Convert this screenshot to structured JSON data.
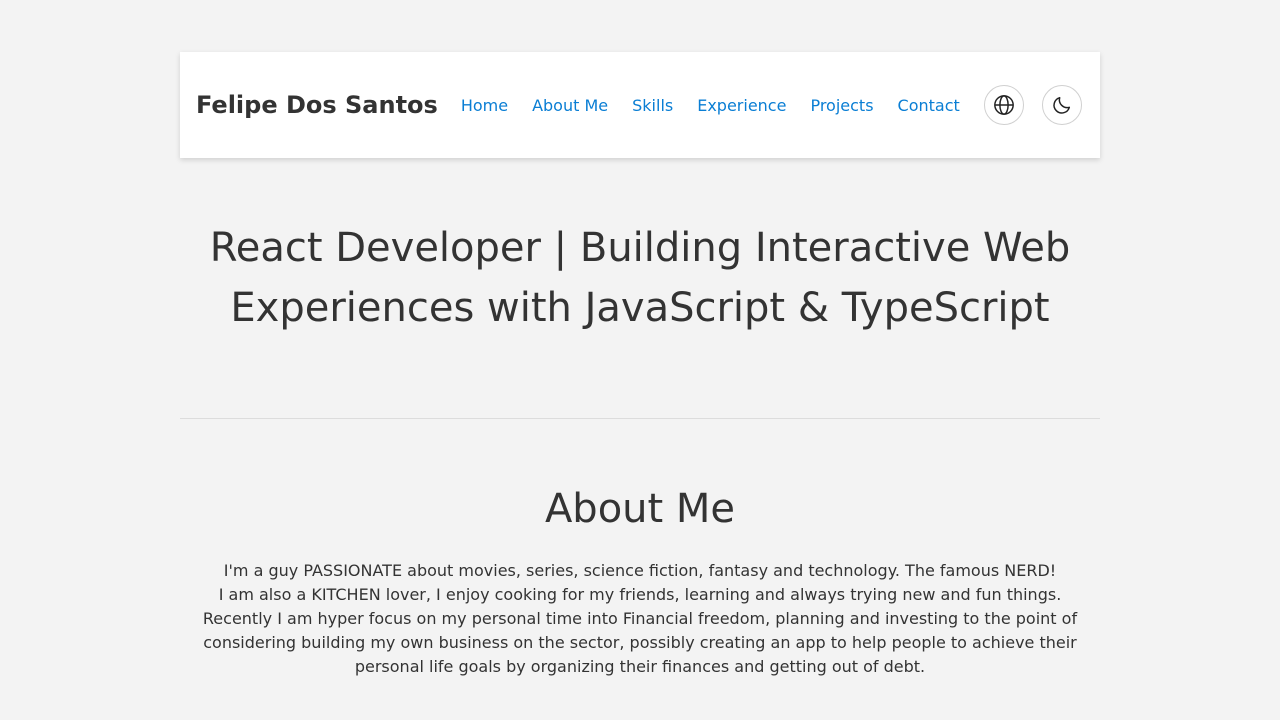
{
  "header": {
    "brand": "Felipe Dos Santos",
    "nav": [
      {
        "label": "Home"
      },
      {
        "label": "About Me"
      },
      {
        "label": "Skills"
      },
      {
        "label": "Experience"
      },
      {
        "label": "Projects"
      },
      {
        "label": "Contact"
      }
    ],
    "buttons": {
      "language_icon": "globe-icon",
      "theme_icon": "moon-icon"
    }
  },
  "hero": {
    "title": "React Developer | Building Interactive Web Experiences with JavaScript & TypeScript"
  },
  "about": {
    "heading": "About Me",
    "lines": [
      "I'm a guy PASSIONATE about movies, series, science fiction, fantasy and technology. The famous NERD!",
      "I am also a KITCHEN lover, I enjoy cooking for my friends, learning and always trying new and fun things.",
      "Recently I am hyper focus on my personal time into Financial freedom, planning and investing to the point of considering building my own business on the sector, possibly creating an app to help people to achieve their personal life goals by organizing their finances and getting out of debt."
    ]
  },
  "colors": {
    "background": "#f3f3f3",
    "link": "#0a7ed4",
    "text": "#333333"
  }
}
